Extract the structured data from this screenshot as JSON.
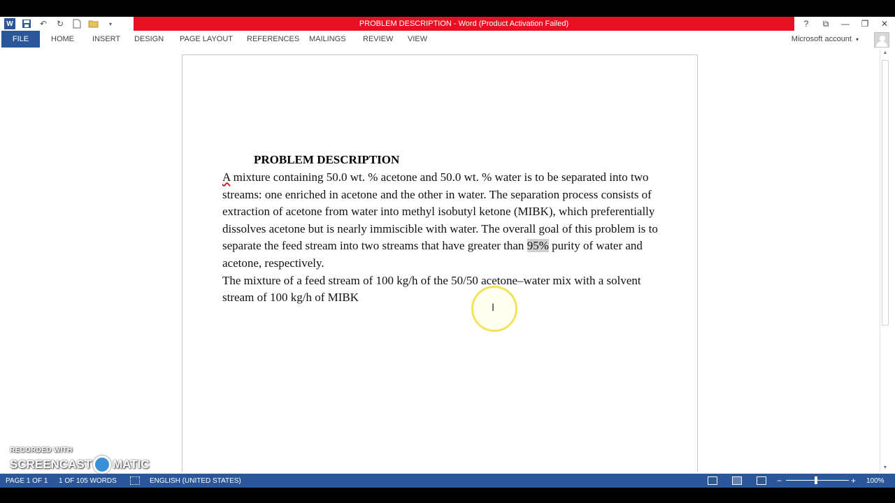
{
  "window": {
    "title": "PROBLEM DESCRIPTION -  Word (Product Activation Failed)",
    "controls": [
      "?",
      "⧉",
      "—",
      "❐",
      "✕"
    ]
  },
  "quick_access": {
    "icons": [
      "word-icon",
      "save-icon",
      "undo-icon",
      "redo-icon",
      "new-doc-icon",
      "open-icon",
      "customize-icon"
    ]
  },
  "ribbon": {
    "file": "FILE",
    "tabs": [
      "HOME",
      "INSERT",
      "DESIGN",
      "PAGE LAYOUT",
      "REFERENCES",
      "MAILINGS",
      "REVIEW",
      "VIEW"
    ],
    "account": "Microsoft account"
  },
  "document": {
    "heading": "PROBLEM DESCRIPTION",
    "para1_word_spellchecked": "A",
    "para1_before_highlight": " mixture containing 50.0 wt. % acetone and 50.0 wt. % water is to be separated into two streams: one enriched in acetone and the other in water. The separation process consists of extraction of acetone from water into methyl isobutyl ketone (MIBK), which preferentially dissolves acetone but is nearly immiscible with water. The overall goal of this problem is to separate the feed stream into two streams that have greater than ",
    "para1_highlight": "95%",
    "para1_after_highlight": " purity of water and acetone, respectively.",
    "para2": "The mixture of a feed stream of 100 kg/h of the 50/50 acetone–water mix with a solvent stream of 100 kg/h of MIBK"
  },
  "watermark": {
    "line1": "RECORDED WITH",
    "line2_left": "SCREENCAST",
    "line2_right": "MATIC"
  },
  "status": {
    "page": "PAGE 1 OF 1",
    "words": "1 OF 105 WORDS",
    "language": "ENGLISH (UNITED STATES)",
    "zoom": "100%",
    "zoom_minus": "−",
    "zoom_plus": "+"
  },
  "colors": {
    "title_bar_red": "#e81123",
    "word_blue": "#2b579a"
  }
}
